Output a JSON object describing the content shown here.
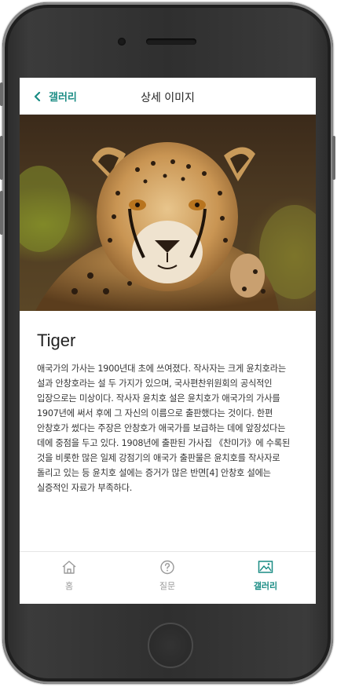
{
  "header": {
    "back_label": "갤러리",
    "title": "상세 이미지"
  },
  "hero": {
    "subject": "cheetah-photo"
  },
  "article": {
    "title": "Tiger",
    "body": "애국가의 가사는 1900년대 초에 쓰여졌다. 작사자는 크게 윤치호라는 설과 안창호라는 설 두 가지가 있으며, 국사편찬위원회의 공식적인 입장으로는 미상이다. 작사자 윤치호 설은 윤치호가 애국가의 가사를 1907년에 써서 후에 그 자신의 이름으로 출판했다는 것이다. 한편 안창호가 썼다는 주장은 안창호가 애국가를 보급하는 데에 앞장섰다는 데에 중점을 두고 있다. 1908년에 출판된 가사집 《찬미가》에 수록된 것을 비롯한 많은 일제 강점기의 애국가 출판물은 윤치호를 작사자로 돌리고 있는 등 윤치호 설에는 증거가 많은 반면[4] 안창호 설에는 실증적인 자료가 부족하다."
  },
  "tabbar": {
    "home": "홈",
    "question": "질문",
    "gallery": "갤러리",
    "active": "gallery"
  },
  "colors": {
    "accent": "#1a8c84",
    "inactive": "#9a9a9a"
  }
}
